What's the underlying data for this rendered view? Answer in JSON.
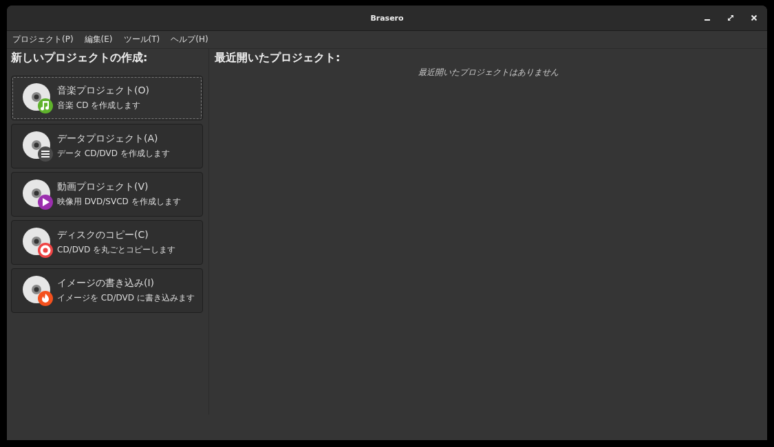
{
  "window": {
    "title": "Brasero"
  },
  "menu": [
    "プロジェクト(P)",
    "編集(E)",
    "ツール(T)",
    "ヘルプ(H)"
  ],
  "new_project": {
    "heading": "新しいプロジェクトの作成:",
    "items": [
      {
        "title": "音楽プロジェクト(O)",
        "description": "音楽 CD を作成します",
        "kind": "music",
        "color": "#5fb32c",
        "focused": true
      },
      {
        "title": "データプロジェクト(A)",
        "description": "データ CD/DVD を作成します",
        "kind": "data",
        "color": "#4a4a4a",
        "focused": false
      },
      {
        "title": "動画プロジェクト(V)",
        "description": "映像用 DVD/SVCD を作成します",
        "kind": "video",
        "color": "#9b2fae",
        "focused": false
      },
      {
        "title": "ディスクのコピー(C)",
        "description": "CD/DVD を丸ごとコピーします",
        "kind": "copy",
        "color": "#ef4444",
        "focused": false
      },
      {
        "title": "イメージの書き込み(I)",
        "description": "イメージを CD/DVD に書き込みます",
        "kind": "burn",
        "color": "#f4511e",
        "focused": false
      }
    ]
  },
  "recent": {
    "heading": "最近開いたプロジェクト:",
    "empty_message": "最近開いたプロジェクトはありません"
  }
}
